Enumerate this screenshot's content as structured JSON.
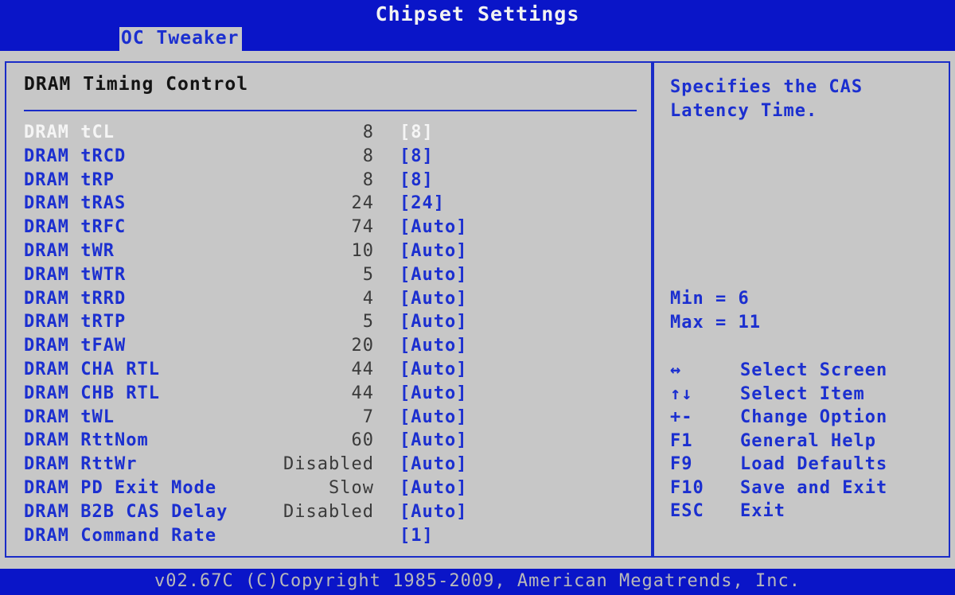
{
  "header": {
    "title": "Chipset Settings",
    "tab_label": "OC Tweaker"
  },
  "section": {
    "title": "DRAM Timing Control"
  },
  "rows": [
    {
      "label": "DRAM tCL",
      "value": "8",
      "setting": "[8]",
      "selected": true
    },
    {
      "label": "DRAM tRCD",
      "value": "8",
      "setting": "[8]"
    },
    {
      "label": "DRAM tRP",
      "value": "8",
      "setting": "[8]"
    },
    {
      "label": "DRAM tRAS",
      "value": "24",
      "setting": "[24]"
    },
    {
      "label": "DRAM tRFC",
      "value": "74",
      "setting": "[Auto]"
    },
    {
      "label": "DRAM tWR",
      "value": "10",
      "setting": "[Auto]"
    },
    {
      "label": "DRAM tWTR",
      "value": "5",
      "setting": "[Auto]"
    },
    {
      "label": "DRAM tRRD",
      "value": "4",
      "setting": "[Auto]"
    },
    {
      "label": "DRAM tRTP",
      "value": "5",
      "setting": "[Auto]"
    },
    {
      "label": "DRAM tFAW",
      "value": "20",
      "setting": "[Auto]"
    },
    {
      "label": "DRAM CHA RTL",
      "value": "44",
      "setting": "[Auto]"
    },
    {
      "label": "DRAM CHB RTL",
      "value": "44",
      "setting": "[Auto]"
    },
    {
      "label": "DRAM tWL",
      "value": "7",
      "setting": "[Auto]"
    },
    {
      "label": "DRAM RttNom",
      "value": "60",
      "setting": "[Auto]"
    },
    {
      "label": "DRAM RttWr",
      "value": "Disabled",
      "setting": "[Auto]"
    },
    {
      "label": "DRAM PD Exit Mode",
      "value": "Slow",
      "setting": "[Auto]"
    },
    {
      "label": "DRAM B2B CAS Delay",
      "value": "Disabled",
      "setting": "[Auto]"
    },
    {
      "label": "DRAM Command Rate",
      "value": "",
      "setting": "[1]"
    }
  ],
  "help": {
    "description": "Specifies the CAS\nLatency Time.",
    "min": "Min = 6",
    "max": "Max = 11",
    "keys": [
      {
        "key": "↔",
        "action": "Select Screen"
      },
      {
        "key": "↑↓",
        "action": "Select Item"
      },
      {
        "key": "+-",
        "action": "Change Option"
      },
      {
        "key": "F1",
        "action": "General Help"
      },
      {
        "key": "F9",
        "action": "Load Defaults"
      },
      {
        "key": "F10",
        "action": "Save and Exit"
      },
      {
        "key": "ESC",
        "action": "Exit"
      }
    ]
  },
  "footer": {
    "text": "v02.67C (C)Copyright 1985-2009, American Megatrends, Inc."
  },
  "colors": {
    "bar_blue": "#0a15c8",
    "text_blue": "#1b2fd0",
    "background_gray": "#c7c7c7",
    "selected_white": "#f5f5f5"
  }
}
